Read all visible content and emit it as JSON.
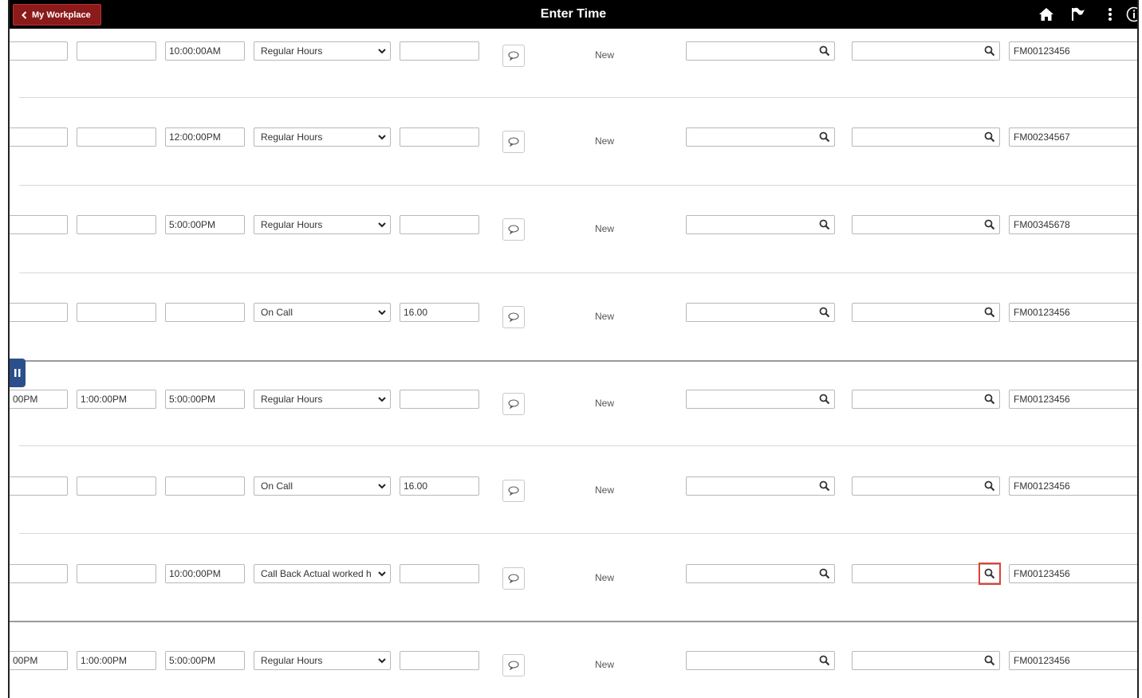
{
  "header": {
    "back_label": "My Workplace",
    "title": "Enter Time",
    "icons": [
      "home-icon",
      "flag-icon",
      "more-vertical-icon",
      "info-icon"
    ]
  },
  "rows": [
    {
      "c1": "",
      "c2": "",
      "c3": "10:00:00AM",
      "trc": "Regular Hours",
      "qty": "",
      "status": "New",
      "taskcode": "FM00123456"
    },
    {
      "c1": "",
      "c2": "",
      "c3": "12:00:00PM",
      "trc": "Regular Hours",
      "qty": "",
      "status": "New",
      "taskcode": "FM00234567"
    },
    {
      "c1": "",
      "c2": "",
      "c3": "5:00:00PM",
      "trc": "Regular Hours",
      "qty": "",
      "status": "New",
      "taskcode": "FM00345678"
    },
    {
      "c1": "",
      "c2": "",
      "c3": "",
      "trc": "On Call",
      "qty": "16.00",
      "status": "New",
      "taskcode": "FM00123456"
    },
    {
      "c1": "00PM",
      "c2": "1:00:00PM",
      "c3": "5:00:00PM",
      "trc": "Regular Hours",
      "qty": "",
      "status": "New",
      "taskcode": "FM00123456"
    },
    {
      "c1": "",
      "c2": "",
      "c3": "",
      "trc": "On Call",
      "qty": "16.00",
      "status": "New",
      "taskcode": "FM00123456"
    },
    {
      "c1": "",
      "c2": "",
      "c3": "10:00:00PM",
      "trc": "Call Back Actual worked h",
      "qty": "",
      "status": "New",
      "taskcode": "FM00123456"
    },
    {
      "c1": "00PM",
      "c2": "1:00:00PM",
      "c3": "5:00:00PM",
      "trc": "Regular Hours",
      "qty": "",
      "status": "New",
      "taskcode": "FM00123456"
    }
  ],
  "highlighted_lookup": {
    "row": 7,
    "column": "second-lookup"
  },
  "colors": {
    "header_bg": "#000000",
    "back_button_bg": "#8b1a1a",
    "highlight": "#e0413a",
    "pause_tab": "#2b4f8c"
  }
}
